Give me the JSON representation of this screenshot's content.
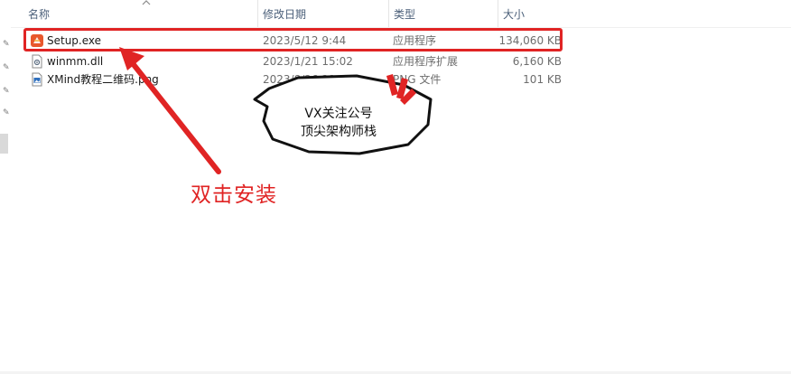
{
  "columns": {
    "name": "名称",
    "date": "修改日期",
    "type": "类型",
    "size": "大小"
  },
  "files": [
    {
      "name": "Setup.exe",
      "date": "2023/5/12 9:44",
      "type": "应用程序",
      "size": "134,060 KB",
      "icon": "setup-app-icon"
    },
    {
      "name": "winmm.dll",
      "date": "2023/1/21 15:02",
      "type": "应用程序扩展",
      "size": "6,160 KB",
      "icon": "dll-file-icon"
    },
    {
      "name": "XMind教程二维码.png",
      "date": "2023/8/26 22:59",
      "type": "PNG 文件",
      "size": "101 KB",
      "icon": "image-file-icon"
    }
  ],
  "annotations": {
    "instruction": "双击安装",
    "bubble_line1": "VX关注公号",
    "bubble_line2": "顶尖架构师栈",
    "accent_color": "#e02424"
  }
}
